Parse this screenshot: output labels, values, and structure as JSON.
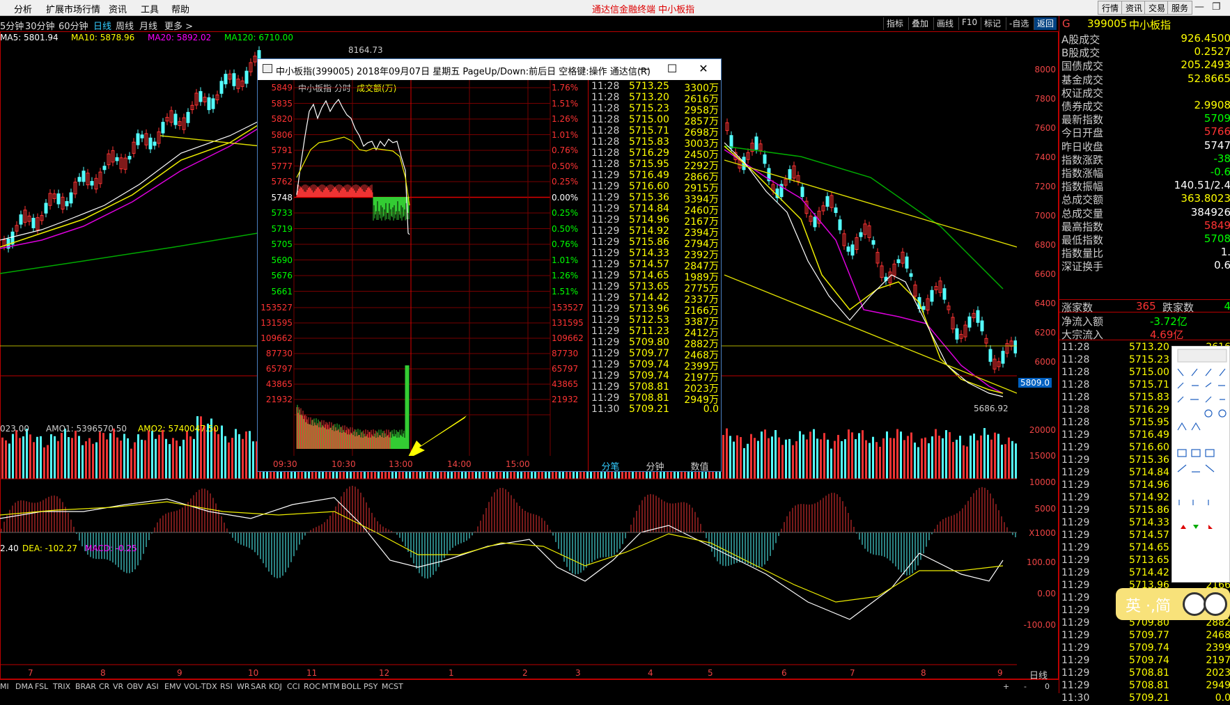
{
  "menubar": {
    "items": [
      "分析",
      "扩展市场行情",
      "资讯",
      "工具",
      "帮助"
    ],
    "center_title": "通达信金融终端  中小板指",
    "right_buttons": [
      "行情",
      "资讯",
      "交易",
      "服务"
    ]
  },
  "period_bar": {
    "items": [
      "5分钟",
      "30分钟",
      "60分钟",
      "日线",
      "周线",
      "月线",
      "更多 >"
    ],
    "active": "日线"
  },
  "toolbar": {
    "items": [
      "指标",
      "叠加",
      "画线",
      "F10",
      "标记",
      "-自选",
      "返回"
    ]
  },
  "ma_legend": {
    "ma5": "MA5: 5801.94",
    "ma10": "MA10: 5878.96",
    "ma20": "MA20: 5892.02",
    "ma120": "MA120: 6710.00"
  },
  "volume_legend": {
    "vol": "023.00",
    "amo1": "AMO1: 5396570.50",
    "amo2": "AMO2: 5740047.50"
  },
  "macd_legend": {
    "dif": "2.40",
    "dea": "DEA: -102.27",
    "macd": "MACD: -0.25"
  },
  "main_axis": [
    "8000",
    "7800",
    "7600",
    "7400",
    "7200",
    "7000",
    "6800",
    "6600",
    "6400",
    "6200",
    "6000",
    "5800"
  ],
  "vol_axis": [
    "20000",
    "15000",
    "10000",
    "5000",
    "X1000"
  ],
  "macd_axis": [
    "100.00",
    "0.00",
    "-100.00"
  ],
  "price_markers": {
    "high": "8164.73",
    "low": "5686.92",
    "current": "5809.0"
  },
  "date_axis": [
    "7",
    "8",
    "9",
    "10",
    "11",
    "12",
    "1",
    "2",
    "3",
    "4",
    "5",
    "6",
    "7",
    "8",
    "9"
  ],
  "date_axis_right": "日线",
  "bottom_tabs": [
    "MI",
    "DMA",
    "FSL",
    "TRIX",
    "BRAR",
    "CR",
    "VR",
    "OBV",
    "ASI",
    "EMV",
    "VOL-TDX",
    "RSI",
    "WR",
    "SAR",
    "KDJ",
    "CCI",
    "ROC",
    "MTM",
    "BOLL",
    "PSY",
    "MCST"
  ],
  "bottom_controls": [
    "+",
    "-",
    "0"
  ],
  "right_panel": {
    "header_code": "399005",
    "header_name": "中小板指",
    "header_letter": "G",
    "rows": [
      {
        "k": "A股成交",
        "v": "926.4500"
      },
      {
        "k": "B股成交",
        "v": "0.2527"
      },
      {
        "k": "国债成交",
        "v": "205.2493"
      },
      {
        "k": "基金成交",
        "v": "52.8665"
      },
      {
        "k": "权证成交",
        "v": ""
      },
      {
        "k": "债券成交",
        "v": "2.9908"
      },
      {
        "k": "最新指数",
        "v": "5709"
      },
      {
        "k": "今日开盘",
        "v": "5766"
      },
      {
        "k": "昨日收盘",
        "v": "5747"
      },
      {
        "k": "指数涨跌",
        "v": "-38"
      },
      {
        "k": "指数涨幅",
        "v": "-0.6"
      },
      {
        "k": "指数振幅",
        "v": "140.51/2.4"
      },
      {
        "k": "总成交额",
        "v": "363.8023"
      },
      {
        "k": "总成交量",
        "v": "384926"
      },
      {
        "k": "最高指数",
        "v": "5849"
      },
      {
        "k": "最低指数",
        "v": "5708"
      },
      {
        "k": "指数量比",
        "v": "1."
      },
      {
        "k": "深证换手",
        "v": "0.6"
      }
    ],
    "updown": {
      "up_label": "涨家数",
      "up": "365",
      "down_label": "跌家数",
      "down": "4"
    },
    "flow": [
      {
        "k": "净流入额",
        "v": "-3.72亿"
      },
      {
        "k": "大宗流入",
        "v": "4.69亿"
      }
    ],
    "ticks": [
      {
        "t": "11:28",
        "p": "5713.20",
        "v": "2616"
      },
      {
        "t": "11:28",
        "p": "5715.23",
        "v": "2958"
      },
      {
        "t": "11:28",
        "p": "5715.00",
        "v": "2857"
      },
      {
        "t": "11:28",
        "p": "5715.71",
        "v": "2698"
      },
      {
        "t": "11:28",
        "p": "5715.83",
        "v": "3003"
      },
      {
        "t": "11:28",
        "p": "5716.29",
        "v": "2450"
      },
      {
        "t": "11:28",
        "p": "5715.95",
        "v": "2292"
      },
      {
        "t": "11:29",
        "p": "5716.49",
        "v": "2866"
      },
      {
        "t": "11:29",
        "p": "5716.60",
        "v": "2915"
      },
      {
        "t": "11:29",
        "p": "5715.36",
        "v": "3394"
      },
      {
        "t": "11:29",
        "p": "5714.84",
        "v": "2460"
      },
      {
        "t": "11:29",
        "p": "5714.96",
        "v": "2167"
      },
      {
        "t": "11:29",
        "p": "5714.92",
        "v": "2394"
      },
      {
        "t": "11:29",
        "p": "5715.86",
        "v": "2794"
      },
      {
        "t": "11:29",
        "p": "5714.33",
        "v": "2392"
      },
      {
        "t": "11:29",
        "p": "5714.57",
        "v": "2847"
      },
      {
        "t": "11:29",
        "p": "5714.65",
        "v": "1989"
      },
      {
        "t": "11:29",
        "p": "5713.65",
        "v": "2775"
      },
      {
        "t": "11:29",
        "p": "5714.42",
        "v": "2337"
      },
      {
        "t": "11:29",
        "p": "5713.96",
        "v": "2166"
      },
      {
        "t": "11:29",
        "p": "5712.53",
        "v": "3387"
      },
      {
        "t": "11:29",
        "p": "5711.23",
        "v": "2412"
      },
      {
        "t": "11:29",
        "p": "5709.80",
        "v": "2882"
      },
      {
        "t": "11:29",
        "p": "5709.77",
        "v": "2468"
      },
      {
        "t": "11:29",
        "p": "5709.74",
        "v": "2399"
      },
      {
        "t": "11:29",
        "p": "5709.74",
        "v": "2197"
      },
      {
        "t": "11:29",
        "p": "5708.81",
        "v": "2023"
      },
      {
        "t": "11:29",
        "p": "5708.81",
        "v": "2949"
      },
      {
        "t": "11:30",
        "p": "5709.21",
        "v": "0.0"
      }
    ]
  },
  "popup": {
    "title": "中小板指(399005) 2018年09月07日 星期五 PageUp/Down:前后日 空格键:操作 通达信(R)",
    "min_label": "—",
    "max_label": "☐",
    "close_label": "✕",
    "chart_header": "中小板指  分时",
    "chart_header_vol": "成交额(万)",
    "left_price_axis": [
      "5849",
      "5835",
      "5820",
      "5806",
      "5791",
      "5777",
      "5762",
      "5748",
      "5733",
      "5719",
      "5705",
      "5690",
      "5676",
      "5661"
    ],
    "right_pct_axis": [
      "1.76%",
      "1.51%",
      "1.26%",
      "1.01%",
      "0.76%",
      "0.50%",
      "0.25%",
      "0.00%",
      "0.25%",
      "0.50%",
      "0.76%",
      "1.01%",
      "1.26%",
      "1.51%"
    ],
    "vol_axis": [
      "153527",
      "131595",
      "109662",
      "87730",
      "65797",
      "43865",
      "21932"
    ],
    "time_axis": [
      "09:30",
      "10:30",
      "13:00",
      "14:00",
      "15:00"
    ],
    "tabs": [
      "分笔",
      "分钟",
      "数值"
    ],
    "ticks": [
      {
        "t": "11:28",
        "p": "5713.25",
        "v": "3300万"
      },
      {
        "t": "11:28",
        "p": "5713.20",
        "v": "2616万"
      },
      {
        "t": "11:28",
        "p": "5715.23",
        "v": "2958万"
      },
      {
        "t": "11:28",
        "p": "5715.00",
        "v": "2857万"
      },
      {
        "t": "11:28",
        "p": "5715.71",
        "v": "2698万"
      },
      {
        "t": "11:28",
        "p": "5715.83",
        "v": "3003万"
      },
      {
        "t": "11:28",
        "p": "5716.29",
        "v": "2450万"
      },
      {
        "t": "11:28",
        "p": "5715.95",
        "v": "2292万"
      },
      {
        "t": "11:29",
        "p": "5716.49",
        "v": "2866万"
      },
      {
        "t": "11:29",
        "p": "5716.60",
        "v": "2915万"
      },
      {
        "t": "11:29",
        "p": "5715.36",
        "v": "3394万"
      },
      {
        "t": "11:29",
        "p": "5714.84",
        "v": "2460万"
      },
      {
        "t": "11:29",
        "p": "5714.96",
        "v": "2167万"
      },
      {
        "t": "11:29",
        "p": "5714.92",
        "v": "2394万"
      },
      {
        "t": "11:29",
        "p": "5715.86",
        "v": "2794万"
      },
      {
        "t": "11:29",
        "p": "5714.33",
        "v": "2392万"
      },
      {
        "t": "11:29",
        "p": "5714.57",
        "v": "2847万"
      },
      {
        "t": "11:29",
        "p": "5714.65",
        "v": "1989万"
      },
      {
        "t": "11:29",
        "p": "5713.65",
        "v": "2775万"
      },
      {
        "t": "11:29",
        "p": "5714.42",
        "v": "2337万"
      },
      {
        "t": "11:29",
        "p": "5713.96",
        "v": "2166万"
      },
      {
        "t": "11:29",
        "p": "5712.53",
        "v": "3387万"
      },
      {
        "t": "11:29",
        "p": "5711.23",
        "v": "2412万"
      },
      {
        "t": "11:29",
        "p": "5709.80",
        "v": "2882万"
      },
      {
        "t": "11:29",
        "p": "5709.77",
        "v": "2468万"
      },
      {
        "t": "11:29",
        "p": "5709.74",
        "v": "2399万"
      },
      {
        "t": "11:29",
        "p": "5709.74",
        "v": "2197万"
      },
      {
        "t": "11:29",
        "p": "5708.81",
        "v": "2023万"
      },
      {
        "t": "11:29",
        "p": "5708.81",
        "v": "2949万"
      },
      {
        "t": "11:30",
        "p": "5709.21",
        "v": "0.0"
      }
    ]
  },
  "ime": {
    "text": "英 ·,简"
  },
  "colors": {
    "up": "#ff3333",
    "down": "#54ffff",
    "ma5": "#ffffff",
    "ma10": "#ffff00",
    "ma20": "#ff00ff",
    "ma120": "#00ff00",
    "trend": "#e0e000"
  }
}
